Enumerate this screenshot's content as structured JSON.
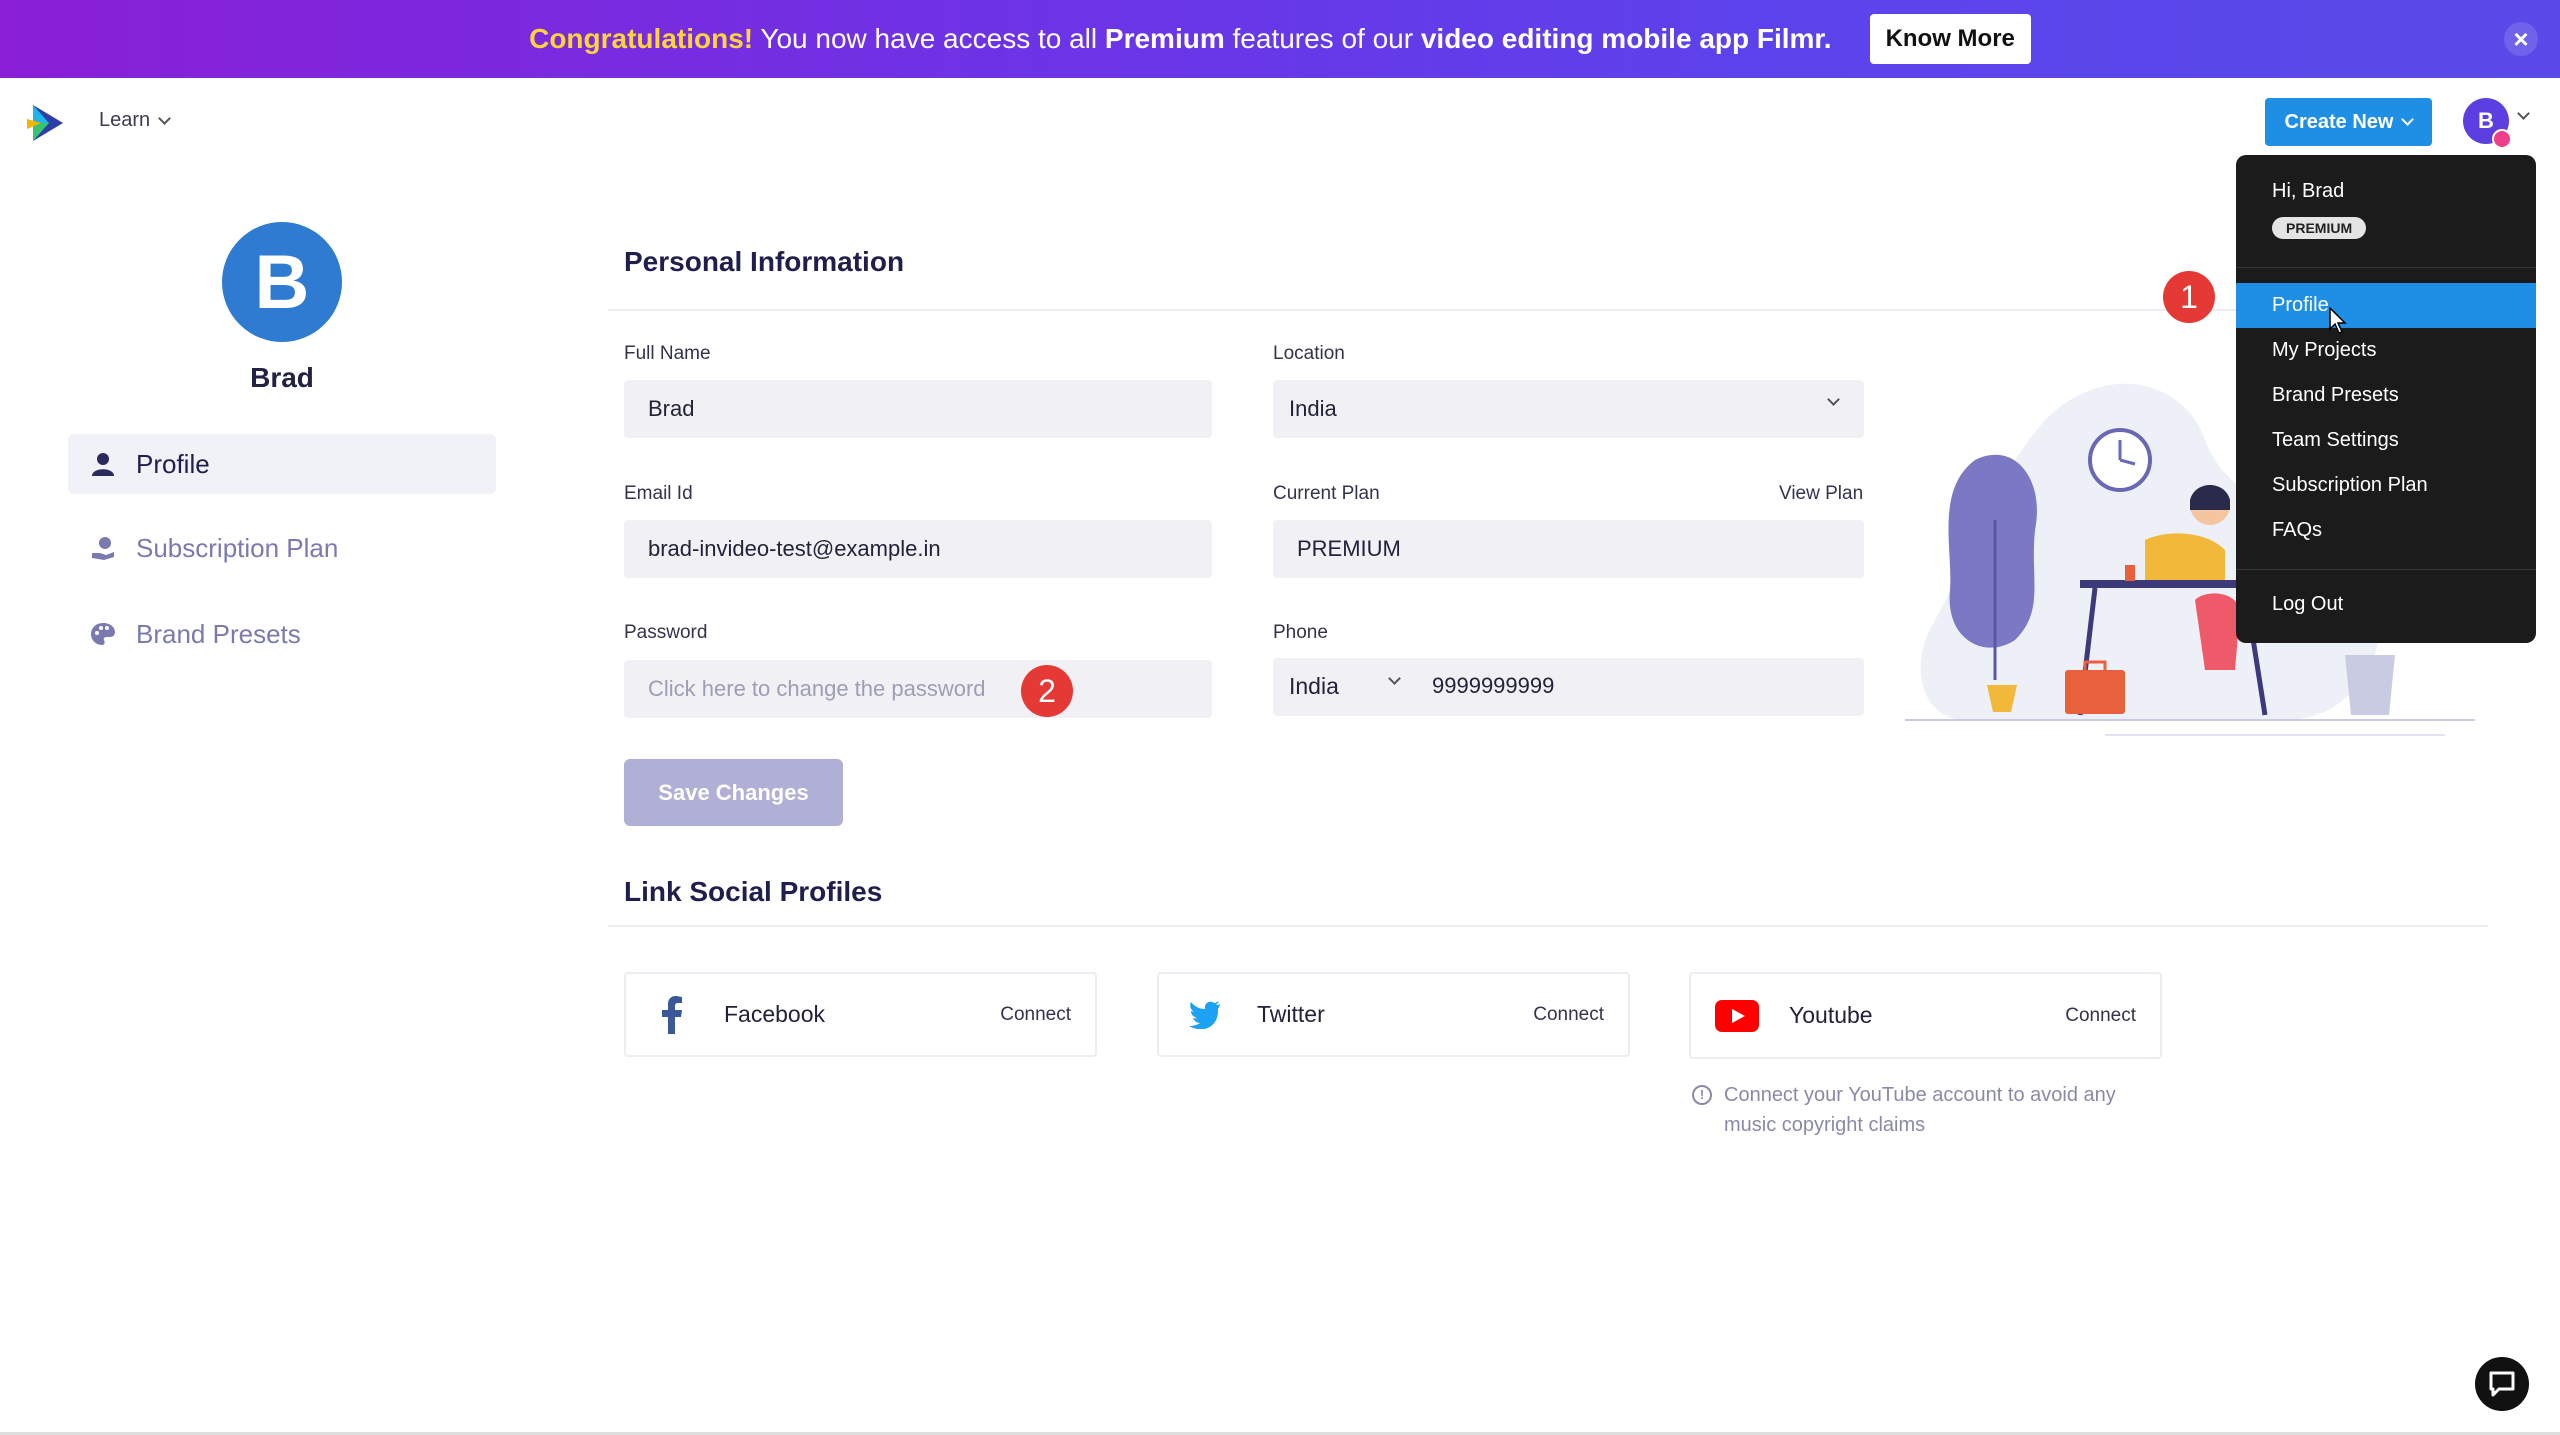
{
  "banner": {
    "highlight": "Congratulations!",
    "text_1": " You now have access to all ",
    "bold_1": "Premium",
    "text_2": " features of our ",
    "bold_2": "video editing mobile app Filmr.",
    "cta": "Know More",
    "close_icon": "close-icon",
    "gradient_start": "#8a1fd6",
    "gradient_end": "#5a4ae8",
    "highlight_color": "#ffd43b"
  },
  "nav": {
    "learn_label": "Learn",
    "create_new_label": "Create New",
    "avatar_initial": "B",
    "accent_color": "#1f8fe6"
  },
  "sidebar": {
    "avatar_initial": "B",
    "user_name": "Brad",
    "items": [
      {
        "label": "Profile",
        "icon": "person-icon",
        "active": true
      },
      {
        "label": "Subscription Plan",
        "icon": "coin-hand-icon",
        "active": false
      },
      {
        "label": "Brand Presets",
        "icon": "palette-icon",
        "active": false
      }
    ]
  },
  "personal": {
    "title": "Personal Information",
    "full_name": {
      "label": "Full Name",
      "value": "Brad"
    },
    "location": {
      "label": "Location",
      "value": "India"
    },
    "email": {
      "label": "Email Id",
      "value": "brad-invideo-test@example.in"
    },
    "plan": {
      "label": "Current Plan",
      "value": "PREMIUM",
      "link": "View Plan"
    },
    "password": {
      "label": "Password",
      "placeholder": "Click here to change the password"
    },
    "phone": {
      "label": "Phone",
      "country": "India",
      "number": "9999999999"
    },
    "save_label": "Save Changes"
  },
  "social": {
    "title": "Link Social Profiles",
    "cards": [
      {
        "name": "Facebook",
        "action": "Connect",
        "icon": "facebook-icon"
      },
      {
        "name": "Twitter",
        "action": "Connect",
        "icon": "twitter-icon"
      },
      {
        "name": "Youtube",
        "action": "Connect",
        "icon": "youtube-icon"
      }
    ],
    "youtube_note": "Connect your YouTube account to avoid any music copyright claims"
  },
  "annotations": {
    "marker_1": "1",
    "marker_2": "2"
  },
  "menu": {
    "greeting": "Hi, Brad",
    "badge": "PREMIUM",
    "items": [
      "Profile",
      "My Projects",
      "Brand Presets",
      "Team Settings",
      "Subscription Plan",
      "FAQs"
    ],
    "logout": "Log Out"
  }
}
